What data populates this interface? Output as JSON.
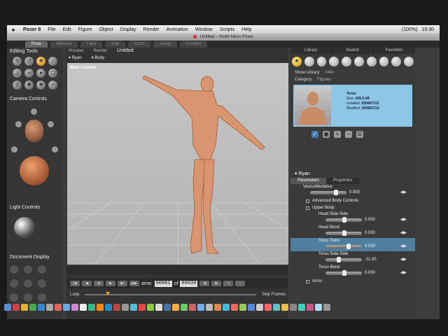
{
  "menubar": {
    "apple": "",
    "app": "Poser 8",
    "items": [
      "File",
      "Edit",
      "Figure",
      "Object",
      "Display",
      "Render",
      "Animation",
      "Window",
      "Scripts",
      "Help"
    ],
    "status": [
      "(100%)",
      "15:30"
    ]
  },
  "window": {
    "title": "Untitled – Smith Micro Poser"
  },
  "rooms": [
    "Pose",
    "Material",
    "Face",
    "Hair",
    "Cloth",
    "Setup",
    "Content"
  ],
  "left_panel": {
    "editing_tools_title": "Editing Tools",
    "camera_controls_title": "Camera Controls",
    "light_controls_title": "Light Controls",
    "document_display_title": "Document Display"
  },
  "viewport": {
    "tabs": [
      "Preview",
      "Render"
    ],
    "doc_title": "Untitled",
    "figure_select": "Ryan",
    "part_select": "Body",
    "camera_label": "Main Camera"
  },
  "playback": {
    "frame_label": "ame:",
    "frame_value": "00001",
    "of_label": "of",
    "total_frames": "00030",
    "loop_label": "Loop",
    "skip_frames_label": "Skip Frames"
  },
  "library": {
    "tabs": [
      "Library",
      "Search",
      "Favorites"
    ],
    "show_library_label": "Show Library:",
    "show_library_value": "<All>",
    "category_label": "Category:",
    "category_value": "Figures",
    "item": {
      "name": "Torso",
      "size_label": "Size:",
      "size": "109.3 kB",
      "installed_label": "Installed:",
      "installed": "2009/07/13",
      "modified_label": "Modified:",
      "modified": "2009/07/13"
    }
  },
  "parameters": {
    "header": "Ryan",
    "tabs": [
      "Parameters",
      "Properties"
    ],
    "vastus": {
      "name": "VastusMedialus",
      "value": "0.900"
    },
    "advanced_group": "Advanced Body Controls",
    "upper_body_group": "Upper Body",
    "rows": [
      {
        "name": "Head Side-Side",
        "value": "0.000"
      },
      {
        "name": "Head Bend",
        "value": "0.000"
      },
      {
        "name": "Torso Twist",
        "value": "8.000"
      },
      {
        "name": "Torso Side-Side",
        "value": "-11.00"
      },
      {
        "name": "Torso Bend",
        "value": "0.000"
      }
    ],
    "arms_group": "Arms"
  },
  "colors": {
    "accent": "#e8a020",
    "highlight_row": "#4f7f9e",
    "library_item_bg": "#8ec7e6"
  }
}
